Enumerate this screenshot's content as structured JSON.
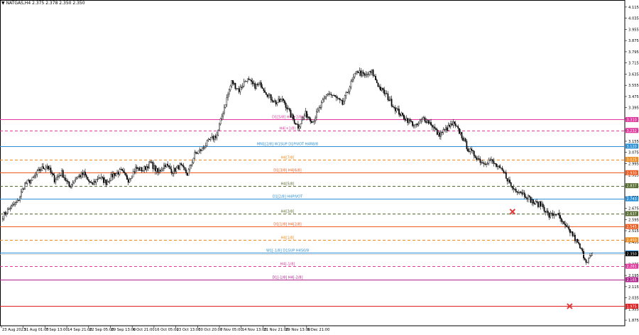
{
  "header": {
    "symbol_line": "NATGAS,H4   2.375 2.378 2.350 2.350",
    "menu_glyph": "▼"
  },
  "chart_data": {
    "type": "candlestick",
    "symbol": "NATGAS",
    "timeframe": "H4",
    "ohlc_last": {
      "open": 2.375,
      "high": 2.378,
      "low": 2.35,
      "close": 2.35
    },
    "ylim": [
      1.835,
      4.155
    ],
    "y_ticks": [
      "4.115",
      "4.035",
      "3.955",
      "3.875",
      "3.795",
      "3.715",
      "3.635",
      "3.555",
      "3.475",
      "3.395",
      "3.315",
      "3.235",
      "3.155",
      "3.075",
      "2.995",
      "2.915",
      "2.835",
      "2.755",
      "2.675",
      "2.595",
      "2.515",
      "2.435",
      "2.355",
      "2.275",
      "2.195",
      "2.115",
      "2.035",
      "1.955",
      "1.875"
    ],
    "x_ticks": [
      "23 Aug 2023",
      "31 Aug 01:00",
      "7 Sep 13:00",
      "14 Sep 21:00",
      "22 Sep 05:00",
      "29 Sep 13:00",
      "6 Oct 21:00",
      "16 Oct 05:00",
      "23 Oct 13:00",
      "30 Oct 20:00",
      "7 Nov 05:00",
      "14 Nov 13:00",
      "21 Nov 21:00",
      "29 Nov 13:00",
      "6 Dec 21:00"
    ],
    "close_path": [
      [
        0,
        2.62
      ],
      [
        3,
        2.68
      ],
      [
        6,
        2.72
      ],
      [
        9,
        2.85
      ],
      [
        12,
        2.88
      ],
      [
        15,
        2.95
      ],
      [
        18,
        2.98
      ],
      [
        21,
        2.88
      ],
      [
        24,
        2.93
      ],
      [
        27,
        2.83
      ],
      [
        30,
        2.9
      ],
      [
        33,
        2.92
      ],
      [
        36,
        2.84
      ],
      [
        39,
        2.9
      ],
      [
        42,
        2.86
      ],
      [
        45,
        2.92
      ],
      [
        48,
        2.94
      ],
      [
        51,
        2.88
      ],
      [
        54,
        2.96
      ],
      [
        57,
        2.95
      ],
      [
        60,
        3.0
      ],
      [
        63,
        2.93
      ],
      [
        66,
        2.99
      ],
      [
        69,
        2.94
      ],
      [
        72,
        2.98
      ],
      [
        75,
        2.92
      ],
      [
        78,
        3.06
      ],
      [
        81,
        3.1
      ],
      [
        84,
        3.16
      ],
      [
        87,
        3.2
      ],
      [
        90,
        3.4
      ],
      [
        93,
        3.58
      ],
      [
        96,
        3.52
      ],
      [
        99,
        3.6
      ],
      [
        102,
        3.55
      ],
      [
        105,
        3.56
      ],
      [
        108,
        3.48
      ],
      [
        111,
        3.43
      ],
      [
        114,
        3.45
      ],
      [
        117,
        3.34
      ],
      [
        120,
        3.26
      ],
      [
        123,
        3.35
      ],
      [
        126,
        3.3
      ],
      [
        129,
        3.4
      ],
      [
        132,
        3.5
      ],
      [
        135,
        3.47
      ],
      [
        138,
        3.42
      ],
      [
        141,
        3.55
      ],
      [
        144,
        3.66
      ],
      [
        147,
        3.62
      ],
      [
        150,
        3.65
      ],
      [
        153,
        3.54
      ],
      [
        156,
        3.48
      ],
      [
        159,
        3.4
      ],
      [
        162,
        3.34
      ],
      [
        165,
        3.3
      ],
      [
        168,
        3.26
      ],
      [
        171,
        3.32
      ],
      [
        174,
        3.28
      ],
      [
        177,
        3.2
      ],
      [
        180,
        3.24
      ],
      [
        183,
        3.28
      ],
      [
        186,
        3.21
      ],
      [
        189,
        3.1
      ],
      [
        192,
        3.05
      ],
      [
        195,
        3.0
      ],
      [
        198,
        3.02
      ],
      [
        201,
        2.97
      ],
      [
        204,
        2.92
      ],
      [
        207,
        2.82
      ],
      [
        210,
        2.8
      ],
      [
        213,
        2.76
      ],
      [
        216,
        2.71
      ],
      [
        219,
        2.7
      ],
      [
        222,
        2.62
      ],
      [
        225,
        2.64
      ],
      [
        228,
        2.55
      ],
      [
        231,
        2.5
      ],
      [
        234,
        2.41
      ],
      [
        237,
        2.3
      ],
      [
        240,
        2.35
      ]
    ],
    "levels": [
      {
        "label": "D1[5/8] H4[+2/8]",
        "value": 3.31,
        "tag": "3.310",
        "color": "#e0389c",
        "style": "solid",
        "label_color": "#e0389c"
      },
      {
        "label": "H4[+1/8]",
        "value": 3.232,
        "tag": "3.232",
        "color": "#e0389c",
        "style": "dashed",
        "label_color": "#e0389c"
      },
      {
        "label": "MN1[2/8] W1SUP D1PIVOT H4R8/8",
        "value": 3.12,
        "tag": "3.120",
        "color": "#2a8fd6",
        "style": "solid",
        "label_color": "#2a8fd6"
      },
      {
        "label": "H4[7/8]",
        "value": 3.025,
        "tag": "3.025",
        "color": "#f08a1e",
        "style": "dashed",
        "label_color": "#f08a1e"
      },
      {
        "label": "D1[3/8] H4[6/8]",
        "value": 2.93,
        "tag": "2.930",
        "color": "#f05a1e",
        "style": "solid",
        "label_color": "#f05a1e"
      },
      {
        "label": "H4[5/8]",
        "value": 2.837,
        "tag": "2.837",
        "color": "#556b2f",
        "style": "dashed",
        "label_color": "#556b2f"
      },
      {
        "label": "D1[2/8] H4PIVOT",
        "value": 2.743,
        "tag": "2.743",
        "color": "#2a8fd6",
        "style": "solid",
        "label_color": "#2a8fd6"
      },
      {
        "label": "H4[3/8]",
        "value": 2.637,
        "tag": "2.637",
        "color": "#556b2f",
        "style": "dashed",
        "label_color": "#556b2f"
      },
      {
        "label": "D1[1/8] H4[2/8]",
        "value": 2.545,
        "tag": "2.545",
        "color": "#f05a1e",
        "style": "solid",
        "label_color": "#f05a1e"
      },
      {
        "label": "H4[1/8]",
        "value": 2.45,
        "tag": "2.450",
        "color": "#f08a1e",
        "style": "dashed",
        "label_color": "#f08a1e"
      },
      {
        "label": "W1[-1/8] D1SUP H4S0/8",
        "value": 2.356,
        "tag": "2.356",
        "color": "#2a8fd6",
        "style": "solid",
        "label_color": "#2a8fd6"
      },
      {
        "label": "H4[-1/8]",
        "value": 2.261,
        "tag": "2.261",
        "color": "#e0389c",
        "style": "dashed",
        "label_color": "#e0389c"
      },
      {
        "label": "D1[-1/8] H4[-2/8]",
        "value": 2.165,
        "tag": "2.165",
        "color": "#b0208c",
        "style": "solid",
        "label_color": "#b0208c"
      },
      {
        "label": "",
        "value": 1.975,
        "tag": "1.975",
        "color": "#e02020",
        "style": "solid",
        "label_color": "#e02020"
      }
    ],
    "current_price": {
      "value": 2.35,
      "tag": "2.350",
      "color": "#000000"
    },
    "markers": [
      {
        "shape": "x",
        "x": 252,
        "y": 2.651,
        "color": "#e03a3a"
      },
      {
        "shape": "x",
        "x": 295,
        "y": 1.975,
        "color": "#e03a3a"
      }
    ],
    "grid": false
  }
}
